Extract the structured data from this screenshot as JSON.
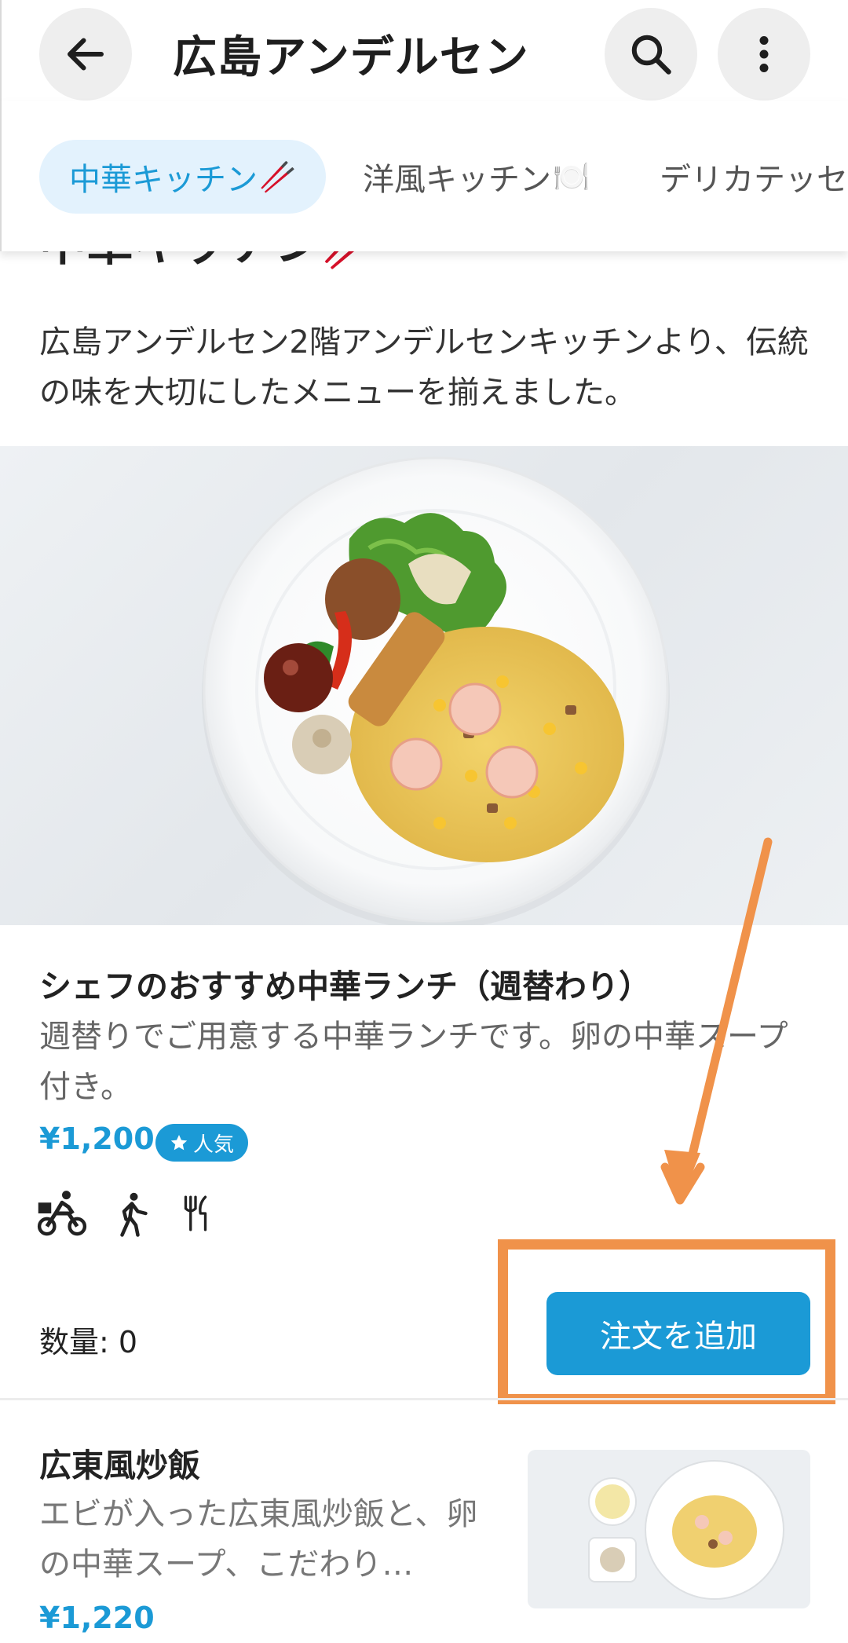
{
  "appbar": {
    "title": "広島アンデルセン",
    "icons": {
      "back": "arrow-left-icon",
      "search": "search-icon",
      "more": "more-vertical-icon"
    }
  },
  "tabs": [
    {
      "label": "中華キッチン",
      "emoji": "🥢",
      "active": true
    },
    {
      "label": "洋風キッチン",
      "emoji": "🍽️",
      "active": false
    },
    {
      "label": "デリカテッセン",
      "emoji": "",
      "active": false
    }
  ],
  "section": {
    "title": "中華キッチン🥢",
    "description": "広島アンデルセン2階アンデルセンキッチンより、伝統の味を大切にしたメニューを揃えました。"
  },
  "items": [
    {
      "title": "シェフのおすすめ中華ランチ（週替わり）",
      "description": "週替りでご用意する中華ランチです。卵の中華スープ付き。",
      "price": "¥1,200",
      "badge": "人気",
      "badge_icon": "star-icon",
      "service_icons": [
        "delivery-bike-icon",
        "walking-pickup-icon",
        "dine-in-cutlery-icon"
      ],
      "quantity_label": "数量: 0",
      "order_button": "注文を追加"
    },
    {
      "title": "広東風炒飯",
      "description": "エビが入った広東風炒飯と、卵の中華スープ、こだわり…",
      "price": "¥1,220"
    }
  ],
  "colors": {
    "accent": "#1b9ad6",
    "tab_active_bg": "#e3f2fd",
    "annotation": "#f0924a"
  }
}
